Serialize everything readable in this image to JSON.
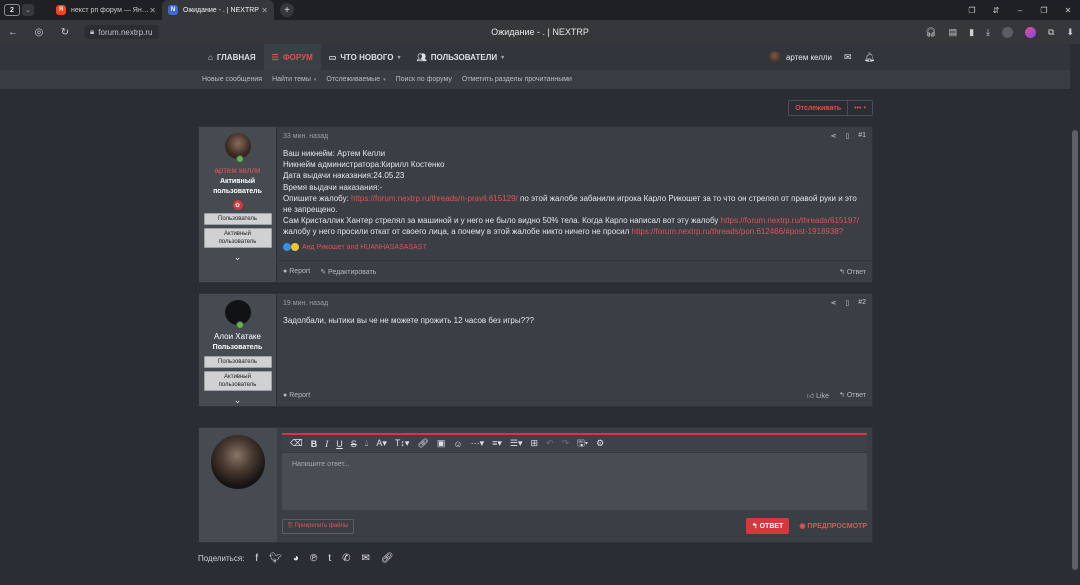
{
  "browser": {
    "tab_count": "2",
    "tabs": [
      {
        "title": "некст рп форум — Яндекс",
        "favicon": "Я",
        "color": "#fc3f1d"
      },
      {
        "title": "Ожидание - . | NEXTRP",
        "favicon": "N",
        "color": "#3d6ad6"
      }
    ],
    "url": "forum.nextrp.ru",
    "page_title": "Ожидание - . | NEXTRP"
  },
  "site_nav": {
    "items": [
      {
        "label": "ГЛАВНАЯ",
        "icon": "home-icon"
      },
      {
        "label": "ФОРУМ",
        "icon": "forum-icon"
      },
      {
        "label": "ЧТО НОВОГО",
        "icon": "comment-icon"
      },
      {
        "label": "ПОЛЬЗОВАТЕЛИ",
        "icon": "users-icon"
      }
    ],
    "user": "артем келли"
  },
  "sub_nav": {
    "items": [
      "Новые сообщения",
      "Найти темы",
      "Отслеживаемые",
      "Поиск по форуму",
      "Отметить разделы прочитанными"
    ]
  },
  "thread": {
    "watch_label": "Отслеживать",
    "watch_more": "•••"
  },
  "posts": [
    {
      "username": "артем келли",
      "user_title": "Активный пользователь",
      "banners": [
        "Пользователь",
        "Активный пользователь"
      ],
      "time": "33 мин. назад",
      "number": "#1",
      "lines": [
        "Ваш никнейм: Артем Келли",
        "Никнейм администратора:Кирилл Костенко",
        "Дата выдачи наказания:24.05.23",
        "Время выдачи наказания:-"
      ],
      "complaint_prefix": "Опишите жалобу: ",
      "complaint_link": "https://forum.nextrp.ru/threads/n-pravil.615129/",
      "complaint_rest": " по этой жалобе забанили игрока Карло Рикошет за то что он стрелял от правой руки и это не запрещено.",
      "para2_a": "Сам Кристаллик Хантер стрелял за машиной и у него не было видно 50% тела. Когда Карло написал вот эту жалобу ",
      "para2_link1": "https://forum.nextrp.ru/threads/615197/",
      "para2_b": " жалобу у него просили откат от своего лица, а почему в этой жалобе никто ничего не просил ",
      "para2_link2": "https://forum.nextrp.ru/threads/pon.612466/#post-1918938?",
      "reactions": "Анд Рикошет and HUANHASASASAS7",
      "actions_left": [
        "Report",
        "Редактировать"
      ],
      "actions_right": [
        "Ответ"
      ]
    },
    {
      "username": "Алои Хатаке",
      "user_title": "Пользователь",
      "banners": [
        "Пользователь",
        "Активный пользователь"
      ],
      "time": "19 мин. назад",
      "number": "#2",
      "body": "Задолбали, нытики вы че не можете прожить 12 часов без игры???",
      "actions_left": [
        "Report"
      ],
      "actions_right": [
        "Like",
        "Ответ"
      ]
    }
  ],
  "reply": {
    "placeholder": "Напишите ответ...",
    "attach": "Прикрепить файлы",
    "submit": "ОТВЕТ",
    "preview": "ПРЕДПРОСМОТР"
  },
  "share": {
    "label": "Поделиться:",
    "icons": [
      "facebook-icon",
      "twitter-icon",
      "reddit-icon",
      "pinterest-icon",
      "tumblr-icon",
      "whatsapp-icon",
      "email-icon",
      "link-icon"
    ]
  },
  "colors": {
    "accent": "#d6373c",
    "link": "#e05454",
    "background": "#2a2d33",
    "post_bg": "#3a3e45",
    "user_panel": "#464a51",
    "online": "#63b745"
  }
}
